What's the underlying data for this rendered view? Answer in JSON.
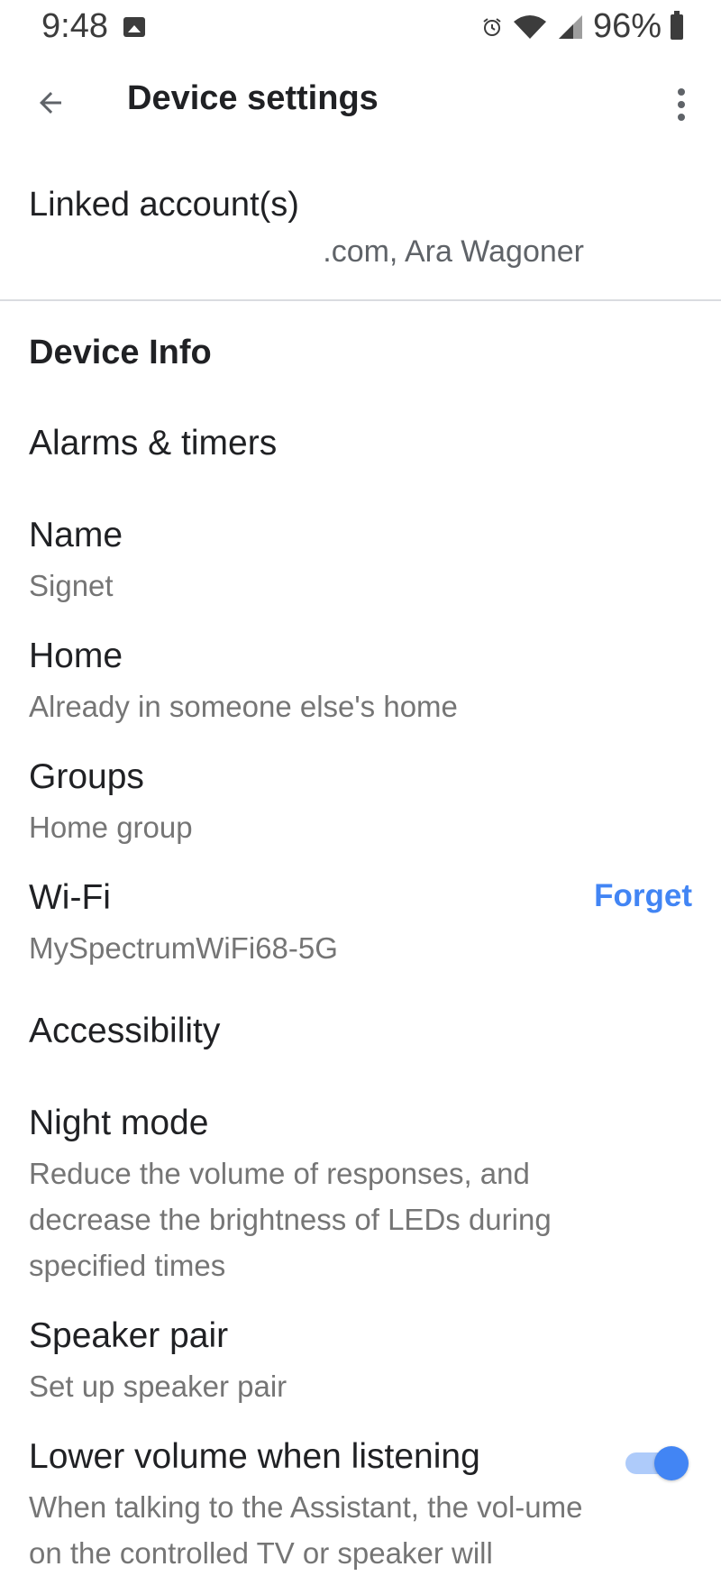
{
  "status_bar": {
    "time": "9:48",
    "battery": "96%"
  },
  "app_bar": {
    "title": "Device settings"
  },
  "linked_accounts": {
    "title": "Linked account(s)",
    "value": ".com, Ara Wagoner"
  },
  "device_info": {
    "header": "Device Info",
    "items": [
      {
        "title": "Alarms & timers",
        "subtitle": ""
      },
      {
        "title": "Name",
        "subtitle": "Signet"
      },
      {
        "title": "Home",
        "subtitle": "Already in someone else's home"
      },
      {
        "title": "Groups",
        "subtitle": "Home group"
      },
      {
        "title": "Wi-Fi",
        "subtitle": "MySpectrumWiFi68-5G",
        "action": "Forget"
      },
      {
        "title": "Accessibility",
        "subtitle": ""
      },
      {
        "title": "Night mode",
        "subtitle": "Reduce the volume of responses, and decrease the brightness of LEDs during specified times"
      },
      {
        "title": "Speaker pair",
        "subtitle": "Set up speaker pair"
      },
      {
        "title": "Lower volume when listening",
        "subtitle": "When talking to the Assistant, the vol-ume on the controlled TV or speaker will",
        "toggle": "on"
      }
    ]
  },
  "colors": {
    "accent": "#4285f4",
    "text_primary": "#202124",
    "text_secondary": "#757575"
  }
}
